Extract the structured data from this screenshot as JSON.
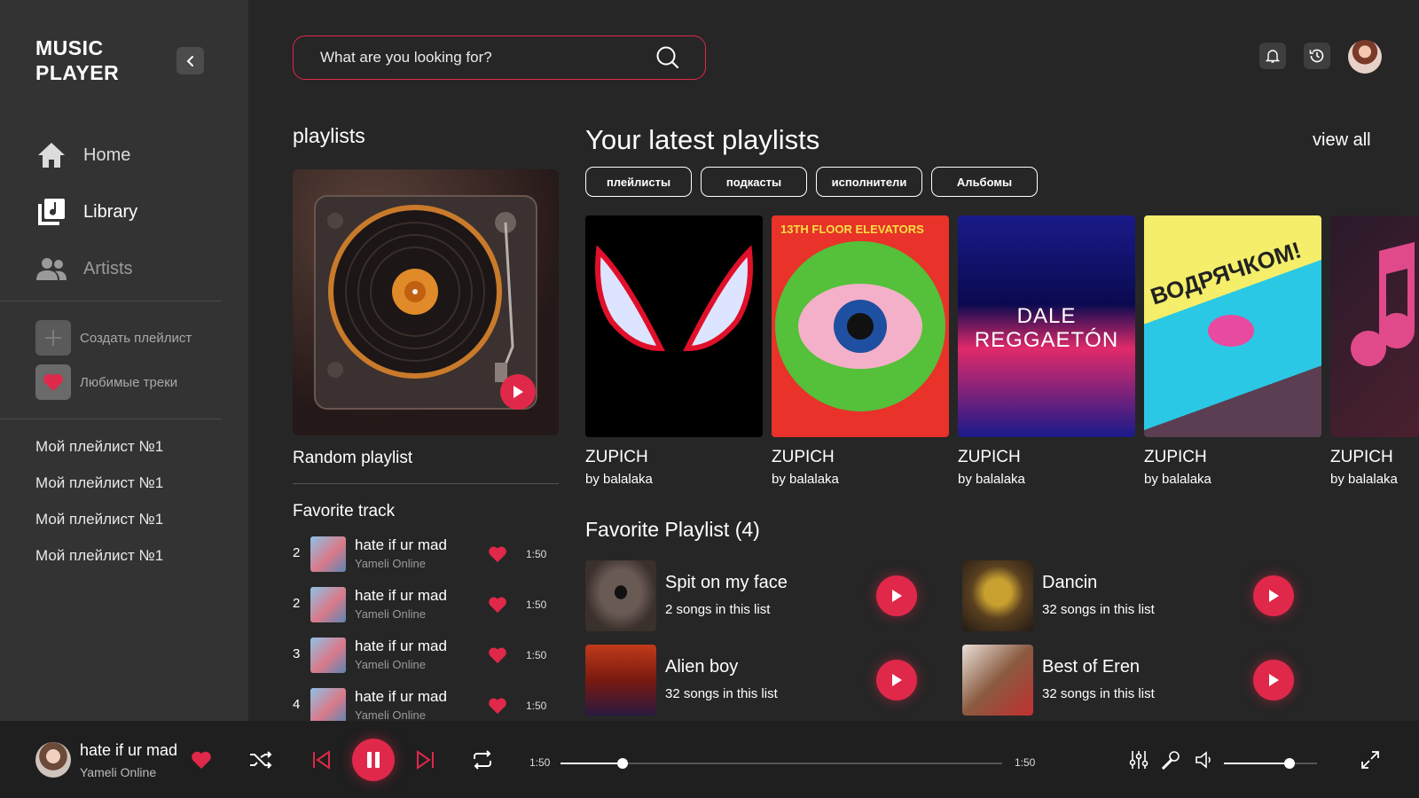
{
  "app": {
    "logo_line1": "MUSIC",
    "logo_line2": "PLAYER"
  },
  "colors": {
    "accent": "#e0284a",
    "sidebar": "#333333",
    "background": "#262626",
    "player": "#1f1f1f"
  },
  "nav": [
    {
      "label": "Home",
      "icon": "home-icon"
    },
    {
      "label": "Library",
      "icon": "library-icon"
    },
    {
      "label": "Artists",
      "icon": "artists-icon"
    }
  ],
  "sidebar_actions": {
    "create": "Создать плейлист",
    "liked": "Любимые треки"
  },
  "my_playlists": [
    "Мой плейлист №1",
    "Мой плейлист №1",
    "Мой плейлист №1",
    "Мой плейлист №1"
  ],
  "search": {
    "placeholder": "What are you looking for?"
  },
  "playlists_section": {
    "title": "playlists",
    "random_name": "Random playlist"
  },
  "favorite_track": {
    "title": "Favorite track",
    "tracks": [
      {
        "num": "2",
        "title": "hate if ur mad",
        "artist": "Yameli Online",
        "duration": "1:50"
      },
      {
        "num": "2",
        "title": "hate if ur mad",
        "artist": "Yameli Online",
        "duration": "1:50"
      },
      {
        "num": "3",
        "title": "hate if ur mad",
        "artist": "Yameli Online",
        "duration": "1:50"
      },
      {
        "num": "4",
        "title": "hate if ur mad",
        "artist": "Yameli Online",
        "duration": "1:50"
      }
    ]
  },
  "latest": {
    "title": "Your latest playlists",
    "view_all": "view all",
    "filters": [
      "плейлисты",
      "подкасты",
      "исполнители",
      "Альбомы"
    ],
    "cards": [
      {
        "name": "ZUPICH",
        "by": "by balalaka",
        "cover_text": ""
      },
      {
        "name": "ZUPICH",
        "by": "by balalaka",
        "cover_text": "13TH FLOOR ELEVATORS"
      },
      {
        "name": "ZUPICH",
        "by": "by balalaka",
        "cover_text": "DALE REGGAETÓN"
      },
      {
        "name": "ZUPICH",
        "by": "by balalaka",
        "cover_text": "ВОДРЯЧКОМ!"
      },
      {
        "name": "ZUPICH",
        "by": "by balalaka",
        "cover_text": ""
      }
    ]
  },
  "favorite_playlists": {
    "title": "Favorite Playlist (4)",
    "items": [
      {
        "name": "Spit on my face",
        "count": "2 songs in this list"
      },
      {
        "name": "Dancin",
        "count": "32 songs in this list"
      },
      {
        "name": "Alien boy",
        "count": "32 songs in this list"
      },
      {
        "name": "Best of Eren",
        "count": "32 songs in this list"
      }
    ]
  },
  "player": {
    "title": "hate if ur mad",
    "artist": "Yameli Online",
    "elapsed": "1:50",
    "total": "1:50",
    "progress": 0.14,
    "volume": 0.7
  }
}
